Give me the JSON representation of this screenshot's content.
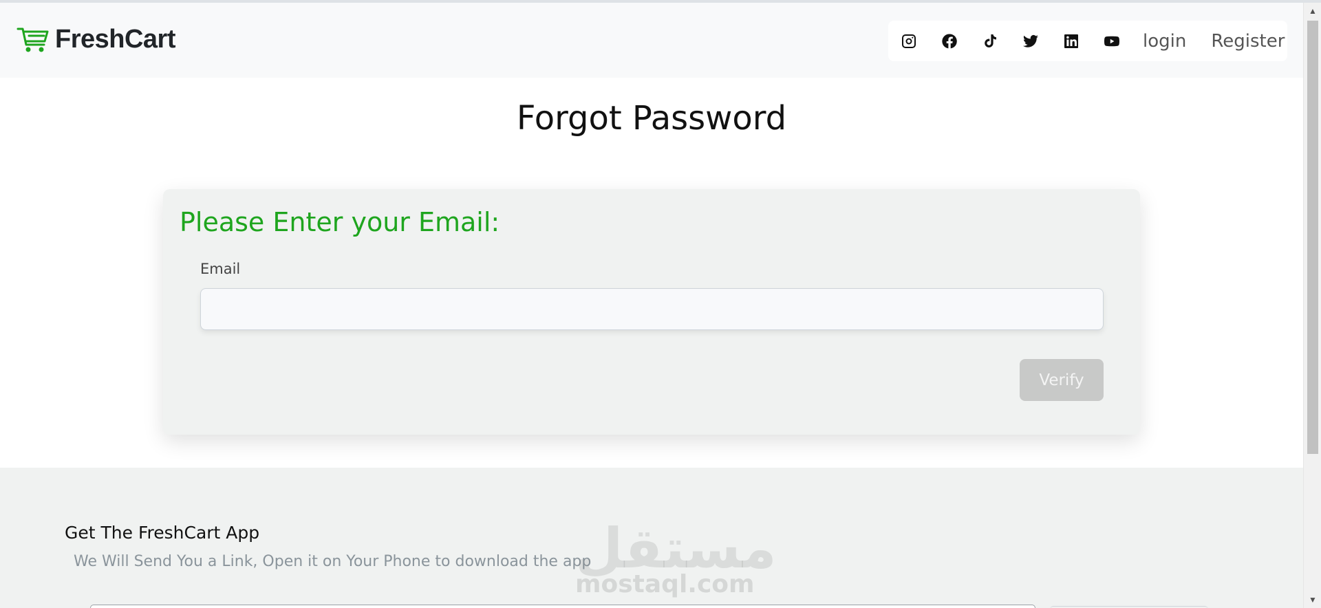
{
  "navbar": {
    "brand": "FreshCart",
    "social_icons": [
      "instagram-icon",
      "facebook-icon",
      "tiktok-icon",
      "twitter-icon",
      "linkedin-icon",
      "youtube-icon"
    ],
    "login_label": "login",
    "register_label": "Register"
  },
  "main": {
    "title": "Forgot Password",
    "card_heading": "Please Enter your Email:",
    "email_label": "Email",
    "email_value": "",
    "verify_label": "Verify"
  },
  "footer": {
    "title": "Get The FreshCart App",
    "subtitle": "We Will Send You a Link, Open it on Your Phone to download the app"
  },
  "watermark": {
    "arabic": "مستقل",
    "latin": "mostaql.com"
  },
  "colors": {
    "accent_green": "#1ea51e",
    "navbar_bg": "#f8f9fa",
    "card_bg": "#f0f2f1",
    "button_disabled": "#c8c9c8"
  }
}
